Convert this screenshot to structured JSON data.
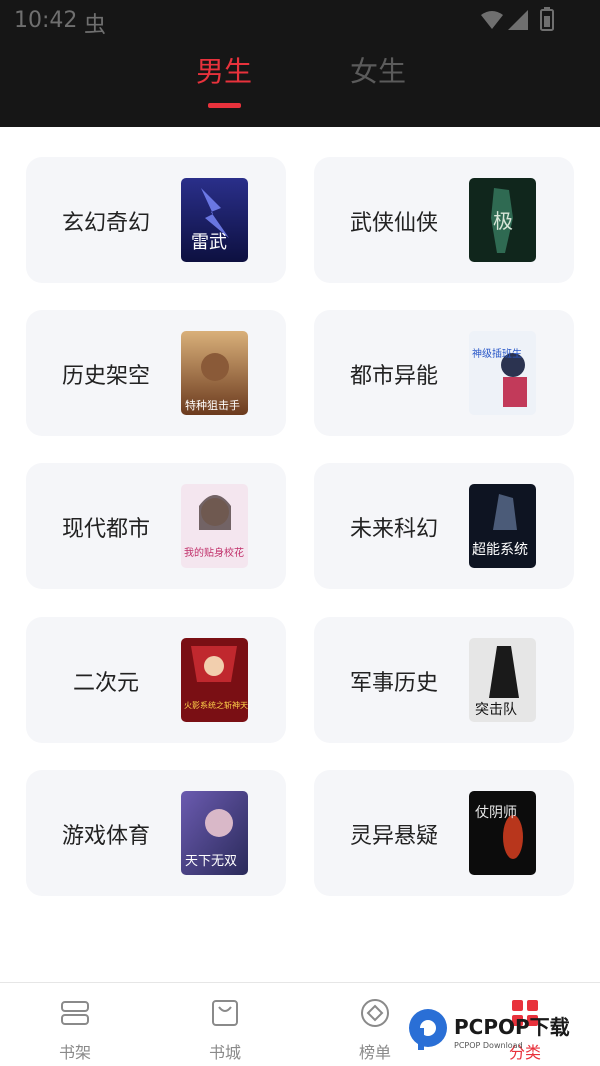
{
  "status_bar": {
    "time": "10:42",
    "bug_glyph": "虫"
  },
  "tabs": [
    {
      "label": "男生",
      "active": true
    },
    {
      "label": "女生",
      "active": false
    }
  ],
  "categories": [
    {
      "label": "玄幻奇幻",
      "cover_text": "雷武"
    },
    {
      "label": "武侠仙侠",
      "cover_text": "极"
    },
    {
      "label": "历史架空",
      "cover_text": "特种狙击手"
    },
    {
      "label": "都市异能",
      "cover_text": "神级插班生"
    },
    {
      "label": "现代都市",
      "cover_text": "我的贴身校花"
    },
    {
      "label": "未来科幻",
      "cover_text": "超能系统"
    },
    {
      "label": "二次元",
      "cover_text": "火影系统之斩神天下"
    },
    {
      "label": "军事历史",
      "cover_text": "突击队"
    },
    {
      "label": "游戏体育",
      "cover_text": "天下无双"
    },
    {
      "label": "灵异悬疑",
      "cover_text": "仗阴师"
    }
  ],
  "bottom_nav": [
    {
      "label": "书架",
      "icon": "bookshelf-icon",
      "active": false
    },
    {
      "label": "书城",
      "icon": "bag-icon",
      "active": false
    },
    {
      "label": "榜单",
      "icon": "diamond-icon",
      "active": false
    },
    {
      "label": "分类",
      "icon": "category-grid-icon",
      "active": true
    }
  ],
  "watermark": {
    "brand": "PCPOP下载",
    "sub": "PCPOP Download"
  },
  "colors": {
    "accent": "#e8323c",
    "header_bg": "#161616",
    "card_bg": "#f5f6f9"
  }
}
